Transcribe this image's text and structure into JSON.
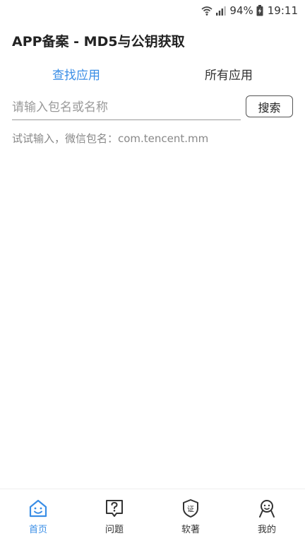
{
  "status_bar": {
    "battery": "94%",
    "time": "19:11"
  },
  "header": {
    "title": "APP备案 - MD5与公钥获取"
  },
  "tabs": [
    {
      "label": "查找应用",
      "active": true
    },
    {
      "label": "所有应用",
      "active": false
    }
  ],
  "search": {
    "placeholder": "请输入包名或名称",
    "value": "",
    "button_label": "搜索"
  },
  "hint": "试试输入，微信包名：com.tencent.mm",
  "bottom_nav": [
    {
      "label": "首页",
      "icon": "home-smile-icon",
      "active": true
    },
    {
      "label": "问题",
      "icon": "question-icon",
      "active": false
    },
    {
      "label": "软著",
      "icon": "certificate-shield-icon",
      "active": false
    },
    {
      "label": "我的",
      "icon": "profile-icon",
      "active": false
    }
  ],
  "colors": {
    "accent": "#3a8ee6",
    "text": "#222222",
    "muted": "#888888"
  }
}
